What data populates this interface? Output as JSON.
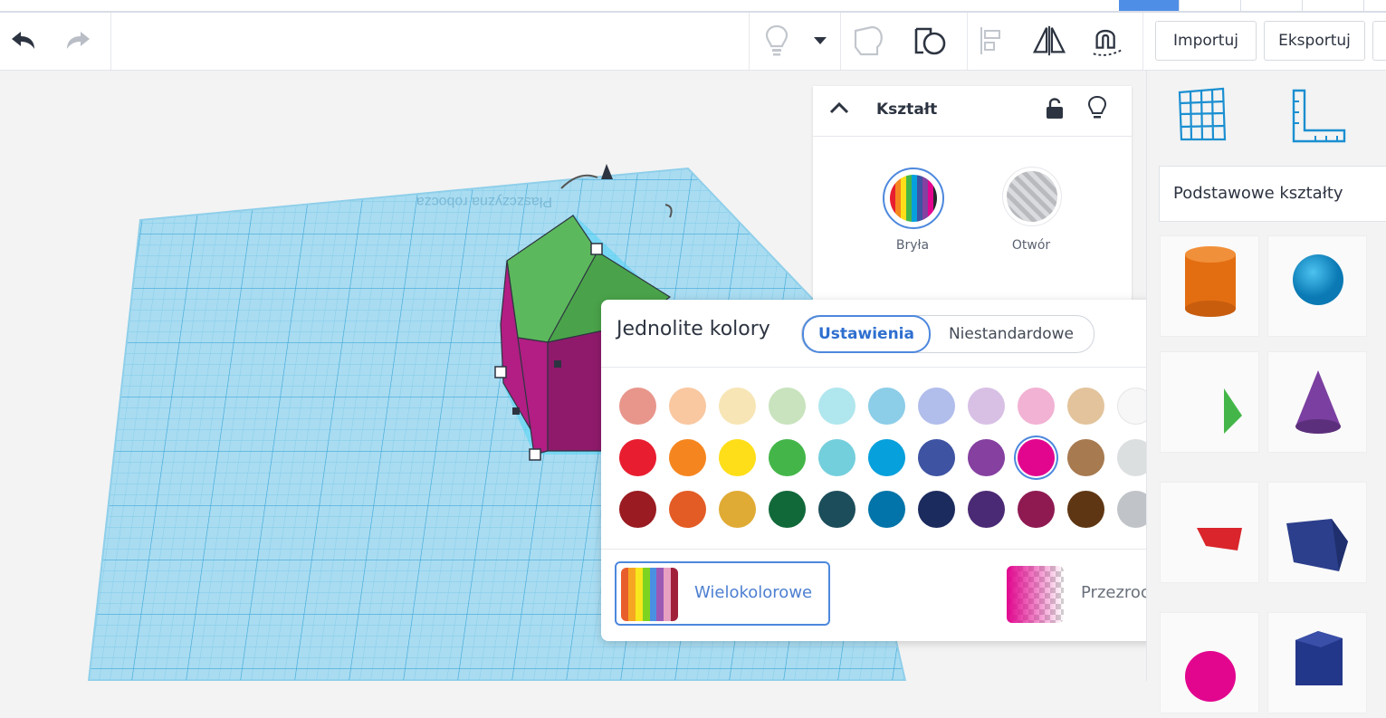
{
  "toolbar": {
    "import_label": "Importuj",
    "export_label": "Eksportuj",
    "icons": [
      "undo-icon",
      "redo-icon",
      "lightbulb-icon",
      "dropdown-icon",
      "shape-outline-icon",
      "group-icon",
      "align-icon",
      "mirror-icon",
      "cruise-icon"
    ]
  },
  "workplane": {
    "label": "Płaszczyzna robocza",
    "grid_color": "#8fd1ec",
    "shape_colors": {
      "top": "#5cb85c",
      "side": "#b21e83"
    }
  },
  "inspector": {
    "title": "Kształt",
    "solid_label": "Bryła",
    "hole_label": "Otwór"
  },
  "color_popover": {
    "title": "Jednolite kolory",
    "tab_active": "Ustawienia",
    "tab_inactive": "Niestandardowe",
    "selected_color": "#e2068f",
    "rows": [
      [
        "#e8968b",
        "#f9c7a0",
        "#f7e5b5",
        "#c8e3bd",
        "#b0e6ee",
        "#8ccde8",
        "#b1bdeb",
        "#d8c0e5",
        "#f1b2d3",
        "#e2c39b",
        "#f7f7f7",
        "#a7a9ab"
      ],
      [
        "#e81e30",
        "#f5861f",
        "#fede19",
        "#44b649",
        "#74cfdc",
        "#06a0dc",
        "#3e53a2",
        "#8540a0",
        "#e2068f",
        "#a77a50",
        "#dcdfe0",
        "#636669"
      ],
      [
        "#9a1b21",
        "#e35c25",
        "#e0ab34",
        "#11693a",
        "#1c4d5b",
        "#0274a9",
        "#1c2b5e",
        "#4b2a75",
        "#8f1a52",
        "#5f3613",
        "#c0c4c9",
        "#262a2e"
      ]
    ],
    "multicolor_label": "Wielokolorowe",
    "multicolor_stripes": [
      "#e85d2c",
      "#f6a623",
      "#f8e71c",
      "#7ed321",
      "#4a90e2",
      "#9b59b6",
      "#e8a0c0",
      "#a0203a"
    ],
    "transparent_label": "Przezroczyste"
  },
  "right_panel": {
    "icons": [
      "workplane-grid-icon",
      "ruler-icon"
    ],
    "category": "Podstawowe kształty",
    "shape_icons": [
      "cylinder-shape",
      "sphere-shape",
      "box-shape",
      "cone-shape",
      "text-shape",
      "polygon-shape",
      "heart-shape",
      "hexagonal-prism-shape"
    ]
  }
}
